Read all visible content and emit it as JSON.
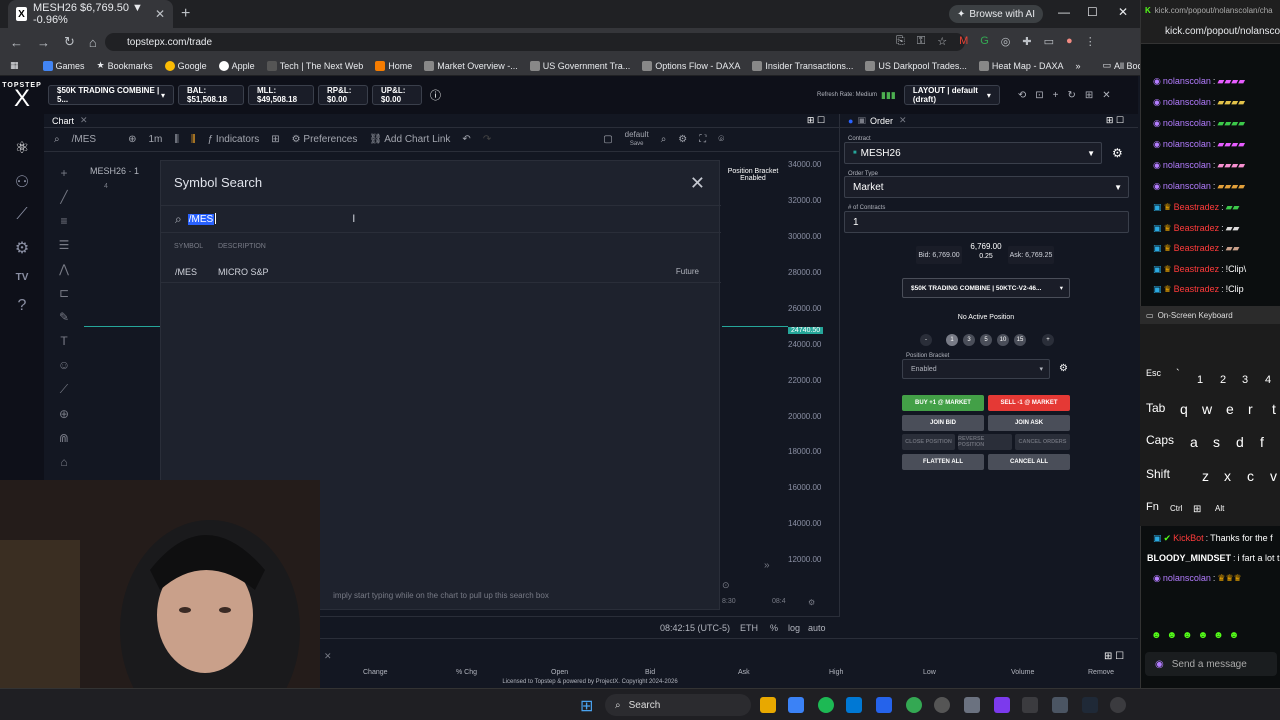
{
  "browser": {
    "tab_title": "MESH26 $6,769.50 ▼ -0.96%",
    "browse_ai": "Browse with AI",
    "url": "topstepx.com/trade",
    "bookmarks": [
      "Games",
      "Bookmarks",
      "Google",
      "Apple",
      "Tech | The Next Web",
      "Home",
      "Market Overview -...",
      "US Government Tra...",
      "Options Flow - DAXA",
      "Insider Transactions...",
      "US Darkpool Trades...",
      "Heat Map - DAXA"
    ],
    "all_bookmarks": "All Bookmarks"
  },
  "header": {
    "logo_small": "TOPSTEP",
    "logo_big": "X",
    "account": "$50K TRADING COMBINE | 5...",
    "bal": "BAL: $51,508.18",
    "mll": "MLL: $49,508.18",
    "rpnl": "RP&L: $0.00",
    "upnl": "UP&L: $0.00",
    "refresh": "Refresh Rate: Medium",
    "layout": "LAYOUT | default (draft)"
  },
  "chart": {
    "panel_title": "Chart",
    "symbol": "/MES",
    "interval": "1m",
    "indicators": "Indicators",
    "preferences": "Preferences",
    "add_link": "Add Chart Link",
    "template": "default",
    "template_sub": "Save",
    "legend": "MESH26 · 1",
    "legend_sub": "4",
    "position_bracket": "Position Bracket",
    "position_bracket_val": "Enabled",
    "price_badge": "24740.50",
    "yaxis": [
      "34000.00",
      "32000.00",
      "30000.00",
      "28000.00",
      "26000.00",
      "24000.00",
      "22000.00",
      "20000.00",
      "18000.00",
      "16000.00",
      "14000.00",
      "12000.00"
    ],
    "xlabels": [
      "8:30",
      "08:4"
    ],
    "time": "08:42:15 (UTC-5)",
    "session": "ETH",
    "pct": "%",
    "log": "log",
    "auto": "auto"
  },
  "modal": {
    "title": "Symbol Search",
    "query": "/MES",
    "col_symbol": "SYMBOL",
    "col_desc": "DESCRIPTION",
    "result_symbol": "/MES",
    "result_desc": "MICRO S&P",
    "result_type": "Future",
    "hint": "imply start typing while on the chart to pull up this search box"
  },
  "order": {
    "panel_title": "Order",
    "contract_label": "Contract",
    "contract": "MESH26",
    "order_type_label": "Order Type",
    "order_type": "Market",
    "contracts_label": "# of Contracts",
    "contracts": "1",
    "bid": "Bid: 6,769.00",
    "last": "6,769.00",
    "spread": "0.25",
    "ask": "Ask: 6,769.25",
    "account": "$50K TRADING COMBINE | 50KTC-V2-46...",
    "no_position": "No Active Position",
    "qty_buttons": [
      "-",
      "1",
      "3",
      "5",
      "10",
      "15",
      "+"
    ],
    "bracket_label": "Position Bracket",
    "bracket": "Enabled",
    "buy": "BUY +1 @ MARKET",
    "sell": "SELL -1 @ MARKET",
    "join_bid": "JOIN BID",
    "join_ask": "JOIN ASK",
    "close_pos": "CLOSE POSITION",
    "reverse": "REVERSE POSITION",
    "cancel_orders": "CANCEL ORDERS",
    "flatten": "FLATTEN ALL",
    "cancel_all": "CANCEL ALL"
  },
  "table": {
    "columns": [
      "Change",
      "% Chg",
      "Open",
      "Bid",
      "Ask",
      "High",
      "Low",
      "Volume",
      "Remove"
    ],
    "footer": "Licensed to Topstep & powered by ProjectX. Copyright 2024-2026"
  },
  "kick": {
    "url": "kick.com/popout/nolanscolan/cha",
    "chat": [
      {
        "user": "nolanscolan",
        "color": "#b37cff",
        "text": ""
      },
      {
        "user": "nolanscolan",
        "color": "#b37cff",
        "text": ""
      },
      {
        "user": "nolanscolan",
        "color": "#b37cff",
        "text": ""
      },
      {
        "user": "nolanscolan",
        "color": "#b37cff",
        "text": ""
      },
      {
        "user": "nolanscolan",
        "color": "#b37cff",
        "text": ""
      },
      {
        "user": "nolanscolan",
        "color": "#b37cff",
        "text": ""
      },
      {
        "user": "Beastradez",
        "color": "#ff3b3b",
        "text": ""
      },
      {
        "user": "Beastradez",
        "color": "#ff3b3b",
        "text": ""
      },
      {
        "user": "Beastradez",
        "color": "#ff3b3b",
        "text": ""
      },
      {
        "user": "Beastradez",
        "color": "#ff3b3b",
        "text": "!Clip\\"
      },
      {
        "user": "Beastradez",
        "color": "#ff3b3b",
        "text": "!Clip"
      }
    ],
    "osk_title": "On-Screen Keyboard",
    "osk_keys": [
      "Esc",
      "`",
      "1",
      "2",
      "3",
      "4",
      "Tab",
      "q",
      "w",
      "e",
      "r",
      "t",
      "Caps",
      "a",
      "s",
      "d",
      "f",
      "Shift",
      "z",
      "x",
      "c",
      "v",
      "Fn",
      "Ctrl",
      "Alt"
    ],
    "lower_chat": [
      {
        "user": "KickBot",
        "color": "#ff3b3b",
        "text": "Thanks for the f"
      },
      {
        "user": "BLOODY_MINDSET",
        "color": "#ffffff",
        "text": "i fart a lot th"
      },
      {
        "user": "nolanscolan",
        "color": "#b37cff",
        "text": ""
      }
    ],
    "send": "Send a message"
  },
  "taskbar": {
    "search": "Search"
  }
}
